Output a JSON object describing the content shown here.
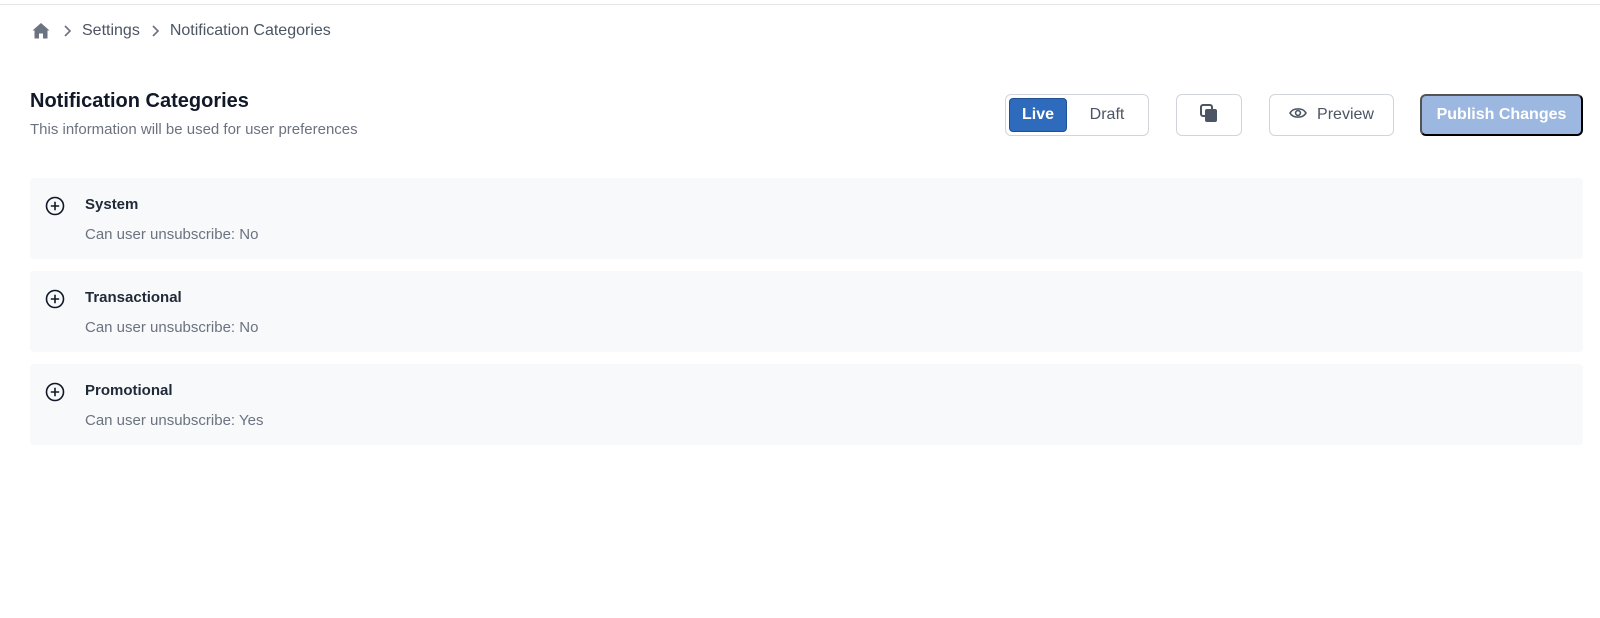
{
  "breadcrumb": {
    "items": [
      "Settings",
      "Notification Categories"
    ]
  },
  "header": {
    "title": "Notification Categories",
    "subtitle": "This information will be used for user preferences"
  },
  "toolbar": {
    "mode_live": "Live",
    "mode_draft": "Draft",
    "active_mode": "Live",
    "preview_label": "Preview",
    "publish_label": "Publish Changes"
  },
  "categories": [
    {
      "name": "System",
      "unsubscribe": "Can user unsubscribe: No"
    },
    {
      "name": "Transactional",
      "unsubscribe": "Can user unsubscribe: No"
    },
    {
      "name": "Promotional",
      "unsubscribe": "Can user unsubscribe: Yes"
    }
  ],
  "colors": {
    "accent": "#2f6bbd",
    "publish_disabled": "#9db8e0",
    "card_bg": "#f8f9fb"
  },
  "icons": {
    "home": "home-icon",
    "separator": "chevron-right-icon",
    "copy": "copy-icon",
    "preview": "eye-icon",
    "expand": "plus-circle-icon"
  }
}
